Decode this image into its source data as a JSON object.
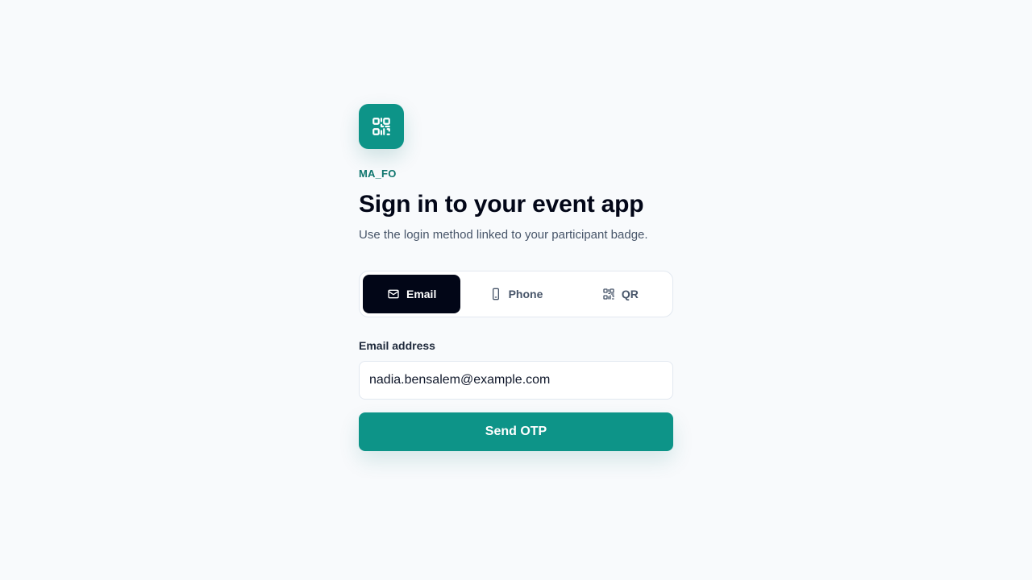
{
  "brand": {
    "name": "MA_FO",
    "logo_icon": "qr-code-icon",
    "accent_color": "#0d9488"
  },
  "header": {
    "title": "Sign in to your event app",
    "subtitle": "Use the login method linked to your participant badge."
  },
  "tabs": [
    {
      "label": "Email",
      "icon": "mail-icon",
      "active": true
    },
    {
      "label": "Phone",
      "icon": "phone-icon",
      "active": false
    },
    {
      "label": "QR",
      "icon": "qr-icon",
      "active": false
    }
  ],
  "form": {
    "email_label": "Email address",
    "email_value": "nadia.bensalem@example.com",
    "submit_label": "Send OTP"
  }
}
